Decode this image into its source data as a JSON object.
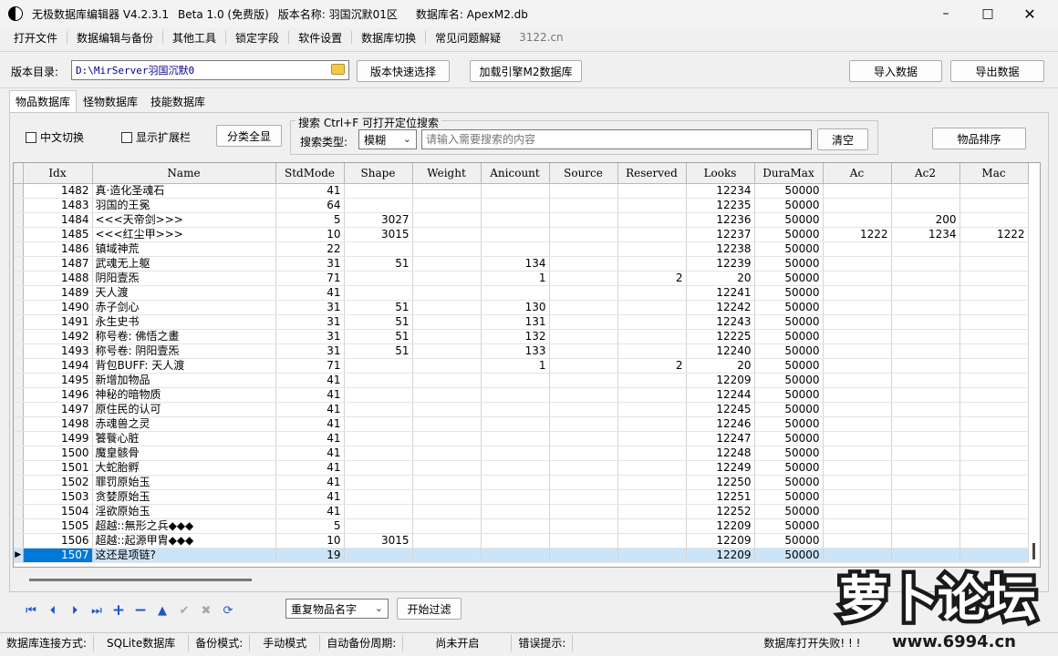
{
  "window": {
    "title_app": "无极数据库编辑器 V4.2.3.1",
    "title_beta": "Beta 1.0 (免费版)",
    "title_version": "版本名称: 羽国沉默01区",
    "title_db": "数据库名: ApexM2.db"
  },
  "menu": {
    "items": [
      "打开文件",
      "数据编辑与备份",
      "其他工具",
      "锁定字段",
      "软件设置",
      "数据库切换",
      "常见问题解疑"
    ],
    "link": "3122.cn"
  },
  "toolbar": {
    "dir_label": "版本目录:",
    "dir_value": "D:\\MirServer羽国沉默0",
    "quick_select": "版本快速选择",
    "load_engine": "加载引擎M2数据库",
    "import": "导入数据",
    "export": "导出数据"
  },
  "tabs": [
    "物品数据库",
    "怪物数据库",
    "技能数据库"
  ],
  "filters": {
    "cn_switch": "中文切换",
    "show_ext": "显示扩展栏",
    "show_all": "分类全显",
    "search_group": "搜索  Ctrl+F 可打开定位搜索",
    "search_type_label": "搜索类型:",
    "search_type_value": "模糊",
    "search_placeholder": "请输入需要搜索的内容",
    "clear": "清空",
    "sort": "物品排序"
  },
  "grid": {
    "columns": [
      "Idx",
      "Name",
      "StdMode",
      "Shape",
      "Weight",
      "Anicount",
      "Source",
      "Reserved",
      "Looks",
      "DuraMax",
      "Ac",
      "Ac2",
      "Mac"
    ],
    "rows": [
      [
        "1482",
        "真·造化圣魂石",
        "41",
        "",
        "",
        "",
        "",
        "",
        "12234",
        "50000",
        "",
        "",
        ""
      ],
      [
        "1483",
        "羽国的王冕",
        "64",
        "",
        "",
        "",
        "",
        "",
        "12235",
        "50000",
        "",
        "",
        ""
      ],
      [
        "1484",
        "<<<天帝剑>>>",
        "5",
        "3027",
        "",
        "",
        "",
        "",
        "12236",
        "50000",
        "",
        "200",
        ""
      ],
      [
        "1485",
        "<<<红尘甲>>>",
        "10",
        "3015",
        "",
        "",
        "",
        "",
        "12237",
        "50000",
        "1222",
        "1234",
        "1222"
      ],
      [
        "1486",
        "镇域神荒",
        "22",
        "",
        "",
        "",
        "",
        "",
        "12238",
        "50000",
        "",
        "",
        ""
      ],
      [
        "1487",
        "武魂无上躯",
        "31",
        "51",
        "",
        "134",
        "",
        "",
        "12239",
        "50000",
        "",
        "",
        ""
      ],
      [
        "1488",
        "阴阳壹炁",
        "71",
        "",
        "",
        "1",
        "",
        "2",
        "20",
        "50000",
        "",
        "",
        ""
      ],
      [
        "1489",
        "天人渡",
        "41",
        "",
        "",
        "",
        "",
        "",
        "12241",
        "50000",
        "",
        "",
        ""
      ],
      [
        "1490",
        "赤子剑心",
        "31",
        "51",
        "",
        "130",
        "",
        "",
        "12242",
        "50000",
        "",
        "",
        ""
      ],
      [
        "1491",
        "永生史书",
        "31",
        "51",
        "",
        "131",
        "",
        "",
        "12243",
        "50000",
        "",
        "",
        ""
      ],
      [
        "1492",
        "称号卷: 佛悟之畫",
        "31",
        "51",
        "",
        "132",
        "",
        "",
        "12225",
        "50000",
        "",
        "",
        ""
      ],
      [
        "1493",
        "称号卷: 阴阳壹炁",
        "31",
        "51",
        "",
        "133",
        "",
        "",
        "12240",
        "50000",
        "",
        "",
        ""
      ],
      [
        "1494",
        "背包BUFF: 天人渡",
        "71",
        "",
        "",
        "1",
        "",
        "2",
        "20",
        "50000",
        "",
        "",
        ""
      ],
      [
        "1495",
        "新增加物品",
        "41",
        "",
        "",
        "",
        "",
        "",
        "12209",
        "50000",
        "",
        "",
        ""
      ],
      [
        "1496",
        "神秘的暗物质",
        "41",
        "",
        "",
        "",
        "",
        "",
        "12244",
        "50000",
        "",
        "",
        ""
      ],
      [
        "1497",
        "原住民的认可",
        "41",
        "",
        "",
        "",
        "",
        "",
        "12245",
        "50000",
        "",
        "",
        ""
      ],
      [
        "1498",
        "赤魂兽之灵",
        "41",
        "",
        "",
        "",
        "",
        "",
        "12246",
        "50000",
        "",
        "",
        ""
      ],
      [
        "1499",
        "饕餮心脏",
        "41",
        "",
        "",
        "",
        "",
        "",
        "12247",
        "50000",
        "",
        "",
        ""
      ],
      [
        "1500",
        "魔皇骸骨",
        "41",
        "",
        "",
        "",
        "",
        "",
        "12248",
        "50000",
        "",
        "",
        ""
      ],
      [
        "1501",
        "大蛇胎孵",
        "41",
        "",
        "",
        "",
        "",
        "",
        "12249",
        "50000",
        "",
        "",
        ""
      ],
      [
        "1502",
        "罪罚原始玉",
        "41",
        "",
        "",
        "",
        "",
        "",
        "12250",
        "50000",
        "",
        "",
        ""
      ],
      [
        "1503",
        "贪婪原始玉",
        "41",
        "",
        "",
        "",
        "",
        "",
        "12251",
        "50000",
        "",
        "",
        ""
      ],
      [
        "1504",
        "淫欲原始玉",
        "41",
        "",
        "",
        "",
        "",
        "",
        "12252",
        "50000",
        "",
        "",
        ""
      ],
      [
        "1505",
        "超越::無形之兵◆◆◆",
        "5",
        "",
        "",
        "",
        "",
        "",
        "12209",
        "50000",
        "",
        "",
        ""
      ],
      [
        "1506",
        "超越::起源甲胄◆◆◆",
        "10",
        "3015",
        "",
        "",
        "",
        "",
        "12209",
        "50000",
        "",
        "",
        ""
      ],
      [
        "1507",
        "这还是项链?",
        "19",
        "",
        "",
        "",
        "",
        "",
        "12209",
        "50000",
        "",
        "",
        ""
      ]
    ],
    "selected_index": 25
  },
  "bottom": {
    "nav_icons": [
      "first-icon",
      "prev-icon",
      "next-icon",
      "last-icon",
      "add-icon",
      "delete-icon",
      "up-icon",
      "confirm-icon",
      "cancel-icon",
      "refresh-icon"
    ],
    "filter_value": "重复物品名字",
    "filter_button": "开始过滤"
  },
  "status": {
    "conn_label": "数据库连接方式:",
    "conn_value": "SQLite数据库",
    "backup_label": "备份模式:",
    "backup_value": "手动模式",
    "auto_label": "自动备份周期:",
    "auto_value": "尚未开启",
    "error_label": "错误提示:",
    "error_value": "数据库打开失败! ! !"
  },
  "watermark": {
    "text": "萝卜论坛",
    "url": "www.6994.cn"
  },
  "colors": {
    "selection": "#cce4f7",
    "selected_idx": "#0078d7",
    "nav_blue": "#1e56c8"
  }
}
